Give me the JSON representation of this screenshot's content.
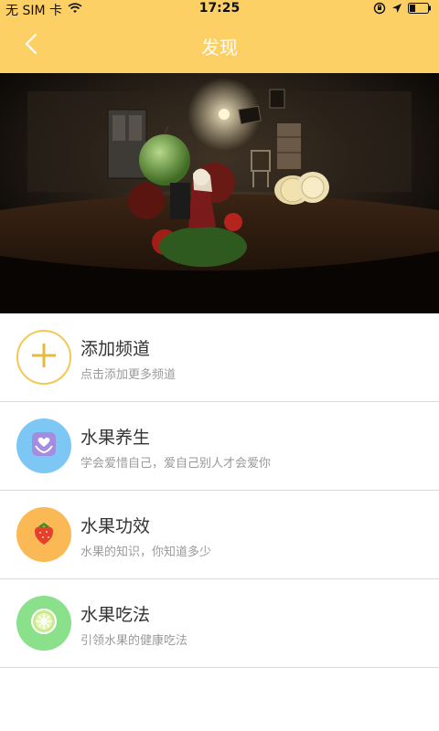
{
  "status_bar": {
    "carrier": "无 SIM 卡",
    "time": "17:25",
    "icons": [
      "wifi-icon",
      "orientation-lock-icon",
      "location-arrow-icon",
      "battery-icon"
    ]
  },
  "navbar": {
    "title": "发现",
    "back_icon": "chevron-left-icon"
  },
  "banner": {
    "description_icon": "fantasy-fruit-room-image"
  },
  "channels": [
    {
      "title": "添加频道",
      "subtitle": "点击添加更多频道",
      "icon": "plus-icon",
      "color": "#ffffff"
    },
    {
      "title": "水果养生",
      "subtitle": "学会爱惜自己，爱自己别人才会爱你",
      "icon": "heart-hands-icon",
      "color": "#7cc7f3"
    },
    {
      "title": "水果功效",
      "subtitle": "水果的知识，你知道多少",
      "icon": "strawberry-icon",
      "color": "#fbb955"
    },
    {
      "title": "水果吃法",
      "subtitle": "引领水果的健康吃法",
      "icon": "lime-slice-icon",
      "color": "#8be08b"
    }
  ],
  "colors": {
    "accent": "#fcd065",
    "divider": "#d9d9d9"
  }
}
